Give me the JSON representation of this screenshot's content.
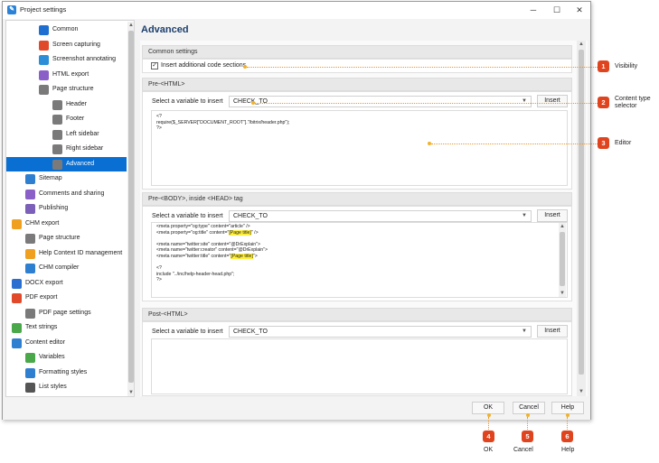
{
  "window": {
    "title": "Project settings"
  },
  "sidebar": {
    "items": [
      {
        "label": "Common",
        "color": "#1e6fd0"
      },
      {
        "label": "Screen capturing",
        "color": "#e04a2a"
      },
      {
        "label": "Screenshot annotating",
        "color": "#2b8ed6"
      },
      {
        "label": "HTML export",
        "color": "#8a60c8"
      },
      {
        "label": "Page structure",
        "color": "#7a7a7a"
      },
      {
        "label": "Header",
        "color": "#7a7a7a"
      },
      {
        "label": "Footer",
        "color": "#7a7a7a"
      },
      {
        "label": "Left sidebar",
        "color": "#7a7a7a"
      },
      {
        "label": "Right sidebar",
        "color": "#7a7a7a"
      },
      {
        "label": "Advanced",
        "color": "#7a7a7a"
      },
      {
        "label": "Sitemap",
        "color": "#2f7fd0"
      },
      {
        "label": "Comments and sharing",
        "color": "#8a60c8"
      },
      {
        "label": "Publishing",
        "color": "#7b5fb8"
      },
      {
        "label": "CHM export",
        "color": "#f0a020"
      },
      {
        "label": "Page structure",
        "color": "#7a7a7a"
      },
      {
        "label": "Help Context ID management",
        "color": "#f0a020"
      },
      {
        "label": "CHM compiler",
        "color": "#2f7fd0"
      },
      {
        "label": "DOCX export",
        "color": "#2a6fd0"
      },
      {
        "label": "PDF export",
        "color": "#e04a2a"
      },
      {
        "label": "PDF page settings",
        "color": "#7a7a7a"
      },
      {
        "label": "Text strings",
        "color": "#4aa84a"
      },
      {
        "label": "Content editor",
        "color": "#2f7fd0"
      },
      {
        "label": "Variables",
        "color": "#4aa84a"
      },
      {
        "label": "Formatting styles",
        "color": "#2f7fd0"
      },
      {
        "label": "List styles",
        "color": "#555555"
      }
    ]
  },
  "main": {
    "title": "Advanced",
    "common": {
      "header": "Common settings",
      "checkbox_label": "Insert additional code sections",
      "checked": true
    },
    "pre_html": {
      "header": "Pre-<HTML>",
      "select_label": "Select a variable to insert",
      "select_value": "CHECK_TO",
      "insert_label": "Insert",
      "code": [
        "<?",
        "require($_SERVER[\"DOCUMENT_ROOT\"].\"/bitrix/header.php\");",
        "?>"
      ]
    },
    "pre_body": {
      "header": "Pre-<BODY>, inside <HEAD> tag",
      "select_label": "Select a variable to insert",
      "select_value": "CHECK_TO",
      "insert_label": "Insert",
      "code": [
        {
          "pre": "<meta property=\"og:type\" content=\"article\" />",
          "hl": "",
          "post": ""
        },
        {
          "pre": "<meta property=\"og:title\" content=\"",
          "hl": "[Page title]",
          "post": "\" />"
        },
        {
          "pre": "",
          "hl": "",
          "post": ""
        },
        {
          "pre": "<meta name=\"twitter:site\" content=\"@DrExplain\">",
          "hl": "",
          "post": ""
        },
        {
          "pre": "<meta name=\"twitter:creator\" content=\"@DrExplain\">",
          "hl": "",
          "post": ""
        },
        {
          "pre": "<meta name=\"twitter:title\" content=\"",
          "hl": "[Page title]",
          "post": "\">"
        },
        {
          "pre": "",
          "hl": "",
          "post": ""
        },
        {
          "pre": "<?",
          "hl": "",
          "post": ""
        },
        {
          "pre": "include \"../inc/help-header-head.php\";",
          "hl": "",
          "post": ""
        },
        {
          "pre": "?>",
          "hl": "",
          "post": ""
        }
      ]
    },
    "post_html": {
      "header": "Post-<HTML>",
      "select_label": "Select a variable to insert",
      "select_value": "CHECK_TO",
      "insert_label": "Insert"
    }
  },
  "footer": {
    "ok": "OK",
    "cancel": "Cancel",
    "help": "Help"
  },
  "callouts": [
    {
      "num": "1",
      "text": "Visibility"
    },
    {
      "num": "2",
      "text": "Content type selector"
    },
    {
      "num": "3",
      "text": "Editor"
    },
    {
      "num": "4",
      "text": "OK"
    },
    {
      "num": "5",
      "text": "Cancel"
    },
    {
      "num": "6",
      "text": "Help"
    }
  ],
  "colors": {
    "accent": "#0a6fd3",
    "title": "#1d3f6e",
    "badge": "#e0441f",
    "highlight": "#ffee3a"
  }
}
